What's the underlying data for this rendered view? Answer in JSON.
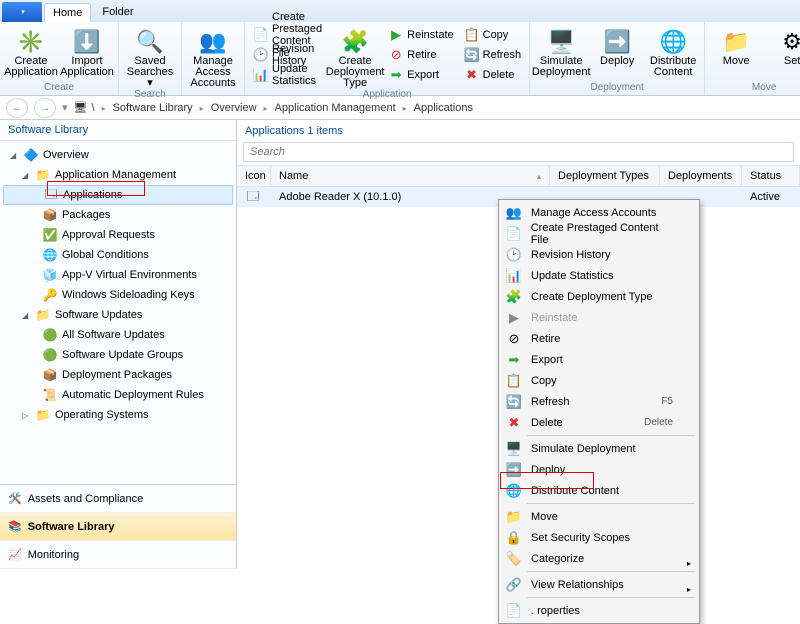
{
  "tabs": {
    "file": "",
    "home": "Home",
    "folder": "Folder"
  },
  "ribbon": {
    "create": {
      "label": "Create",
      "create_app": "Create\nApplication",
      "import_app": "Import\nApplication"
    },
    "search": {
      "label": "Search",
      "saved": "Saved\nSearches ▾"
    },
    "accounts": "Manage Access\nAccounts",
    "app_group": {
      "label": "Application",
      "prestaged": "Create Prestaged Content File",
      "revhist": "Revision History",
      "updstat": "Update Statistics",
      "createdeptype": "Create\nDeployment Type",
      "reinstate": "Reinstate",
      "retire": "Retire",
      "export": "Export",
      "copy": "Copy",
      "refresh": "Refresh",
      "delete": "Delete"
    },
    "deploy_group": {
      "label": "Deployment",
      "simulate": "Simulate\nDeployment",
      "deploy": "Deploy",
      "distribute": "Distribute\nContent"
    },
    "move_group": {
      "label": "Move",
      "move": "Move",
      "set": "Set"
    }
  },
  "breadcrumbs": [
    "\\",
    "Software Library",
    "Overview",
    "Application Management",
    "Applications"
  ],
  "nav": {
    "title": "Software Library",
    "overview": "Overview",
    "appmgmt": "Application Management",
    "applications": "Applications",
    "packages": "Packages",
    "approvals": "Approval Requests",
    "globalcond": "Global Conditions",
    "appv": "App-V Virtual Environments",
    "sideload": "Windows Sideloading Keys",
    "swupdates": "Software Updates",
    "allupd": "All Software Updates",
    "updgroups": "Software Update Groups",
    "deppkg": "Deployment Packages",
    "autorules": "Automatic Deployment Rules",
    "os": "Operating Systems",
    "bottom": {
      "assets": "Assets and Compliance",
      "swlib": "Software Library",
      "monitoring": "Monitoring"
    }
  },
  "main": {
    "count": "Applications 1 items",
    "search_ph": "Search",
    "columns": {
      "icon": "Icon",
      "name": "Name",
      "deptypes": "Deployment Types",
      "deps": "Deployments",
      "status": "Status"
    },
    "row": {
      "name": "Adobe Reader X (10.1.0)",
      "deptypes": "",
      "deps": "",
      "status": "Active"
    }
  },
  "context": {
    "manage_access": "Manage Access Accounts",
    "prestaged": "Create Prestaged Content File",
    "revhist": "Revision History",
    "updstat": "Update Statistics",
    "cdt": "Create Deployment Type",
    "reinstate": "Reinstate",
    "retire": "Retire",
    "export": "Export",
    "copy": "Copy",
    "refresh": "Refresh",
    "refresh_sc": "F5",
    "delete": "Delete",
    "delete_sc": "Delete",
    "simdep": "Simulate Deployment",
    "deploy": "Deploy",
    "distcontent": "Distribute Content",
    "move": "Move",
    "setscope": "Set Security Scopes",
    "categorize": "Categorize",
    "viewrel": "View Relationships",
    "properties": ". roperties"
  }
}
